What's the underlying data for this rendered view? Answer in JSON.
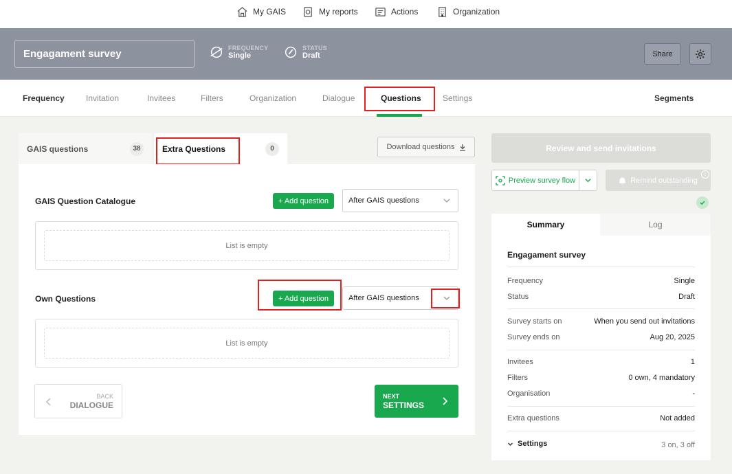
{
  "topnav": {
    "my_gais": "My GAIS",
    "my_reports": "My reports",
    "actions": "Actions",
    "organization": "Organization"
  },
  "header": {
    "survey_title": "Engagament survey",
    "frequency_label": "FREQUENCY",
    "frequency_value": "Single",
    "status_label": "STATUS",
    "status_value": "Draft",
    "share_label": "Share"
  },
  "tabs": {
    "frequency": "Frequency",
    "invitation": "Invitation",
    "invitees": "Invitees",
    "filters": "Filters",
    "organization": "Organization",
    "dialogue": "Dialogue",
    "questions": "Questions",
    "settings": "Settings",
    "segments": "Segments",
    "active": "Questions"
  },
  "subtabs": {
    "gais_label": "GAIS questions",
    "gais_count": "38",
    "extra_label": "Extra Questions",
    "extra_count": "0",
    "download_label": "Download questions"
  },
  "catalogue": {
    "title": "GAIS Question Catalogue",
    "add_label": "+ Add question",
    "position_value": "After GAIS questions",
    "empty_text": "List is empty"
  },
  "own": {
    "title": "Own Questions",
    "add_label": "+ Add question",
    "position_value": "After GAIS questions",
    "empty_text": "List is empty"
  },
  "nav_buttons": {
    "back_label": "BACK",
    "back_value": "DIALOGUE",
    "next_label": "NEXT",
    "next_value": "SETTINGS"
  },
  "sidebar": {
    "review_label": "Review and send invitations",
    "preview_label": "Preview survey flow",
    "remind_label": "Remind outstanding",
    "summary_tab": "Summary",
    "log_tab": "Log",
    "summary_title": "Engagament survey",
    "rows": {
      "frequency_k": "Frequency",
      "frequency_v": "Single",
      "status_k": "Status",
      "status_v": "Draft",
      "starts_k": "Survey starts on",
      "starts_v": "When you send out invitations",
      "ends_k": "Survey ends on",
      "ends_v": "Aug 20, 2025",
      "invitees_k": "Invitees",
      "invitees_v": "1",
      "filters_k": "Filters",
      "filters_v": "0 own, 4 mandatory",
      "organisation_k": "Organisation",
      "organisation_v": "-",
      "extra_k": "Extra questions",
      "extra_v": "Not added",
      "settings_k": "Settings",
      "settings_v": "3 on, 3 off"
    }
  },
  "colors": {
    "accent": "#1aa84f",
    "header_bg": "#8c929e",
    "highlight": "#e02020"
  }
}
